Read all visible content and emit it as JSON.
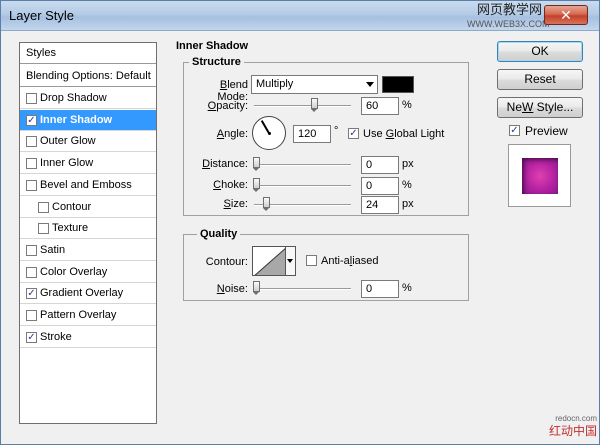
{
  "window": {
    "title": "Layer Style",
    "close_glyph": "✕",
    "watermark_top": "网页教学网",
    "watermark_top_url": "WWW.WEB3X.COM",
    "watermark_bottom_url": "redocn.com",
    "watermark_bottom": "红动中国"
  },
  "styles_list": {
    "items": [
      {
        "label": "Styles",
        "checkbox": false
      },
      {
        "label": "Blending Options: Default",
        "checkbox": false
      },
      {
        "label": "Drop Shadow",
        "checkbox": true,
        "checked": false
      },
      {
        "label": "Inner Shadow",
        "checkbox": true,
        "checked": true,
        "active": true
      },
      {
        "label": "Outer Glow",
        "checkbox": true,
        "checked": false
      },
      {
        "label": "Inner Glow",
        "checkbox": true,
        "checked": false
      },
      {
        "label": "Bevel and Emboss",
        "checkbox": true,
        "checked": false
      },
      {
        "label": "Contour",
        "checkbox": true,
        "checked": false,
        "indent": true
      },
      {
        "label": "Texture",
        "checkbox": true,
        "checked": false,
        "indent": true
      },
      {
        "label": "Satin",
        "checkbox": true,
        "checked": false
      },
      {
        "label": "Color Overlay",
        "checkbox": true,
        "checked": false
      },
      {
        "label": "Gradient Overlay",
        "checkbox": true,
        "checked": true
      },
      {
        "label": "Pattern Overlay",
        "checkbox": true,
        "checked": false
      },
      {
        "label": "Stroke",
        "checkbox": true,
        "checked": true
      }
    ]
  },
  "inner_shadow": {
    "title": "Inner Shadow",
    "structure": {
      "title": "Structure",
      "blend_mode": {
        "label_u": "B",
        "label_rest": "lend Mode:",
        "value": "Multiply",
        "color": "#000000"
      },
      "opacity": {
        "label_u": "O",
        "label_rest": "pacity:",
        "value": "60",
        "unit": "%",
        "fraction": 0.6
      },
      "angle": {
        "label_u": "A",
        "label_rest": "ngle:",
        "value": "120",
        "unit": "°",
        "degrees": 120,
        "global_light_pre": "Use ",
        "global_light_u": "G",
        "global_light_rest": "lobal Light",
        "global_light_checked": true
      },
      "distance": {
        "label_u": "D",
        "label_rest": "istance:",
        "value": "0",
        "unit": "px",
        "fraction": 0.0
      },
      "choke": {
        "label_u": "C",
        "label_rest": "hoke:",
        "value": "0",
        "unit": "%",
        "fraction": 0.0
      },
      "size": {
        "label_u": "S",
        "label_rest": "ize:",
        "value": "24",
        "unit": "px",
        "fraction": 0.1
      }
    },
    "quality": {
      "title": "Quality",
      "contour_label": "Contour:",
      "anti_aliased_pre": "Anti-a",
      "anti_aliased_u": "l",
      "anti_aliased_rest": "iased",
      "anti_aliased_checked": false,
      "noise": {
        "label_u": "N",
        "label_rest": "oise:",
        "value": "0",
        "unit": "%",
        "fraction": 0.0
      }
    }
  },
  "buttons": {
    "ok": "OK",
    "reset": "Reset",
    "new_style_u": "W",
    "new_style_pre": "Ne",
    "new_style_rest": " Style...",
    "preview_label": "Preview",
    "preview_checked": true
  }
}
